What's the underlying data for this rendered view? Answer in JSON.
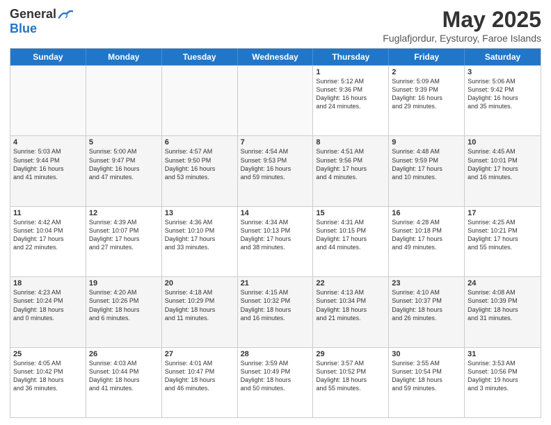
{
  "logo": {
    "general": "General",
    "blue": "Blue"
  },
  "title": "May 2025",
  "subtitle": "Fuglafjordur, Eysturoy, Faroe Islands",
  "headers": [
    "Sunday",
    "Monday",
    "Tuesday",
    "Wednesday",
    "Thursday",
    "Friday",
    "Saturday"
  ],
  "rows": [
    [
      {
        "day": "",
        "info": "",
        "empty": true
      },
      {
        "day": "",
        "info": "",
        "empty": true
      },
      {
        "day": "",
        "info": "",
        "empty": true
      },
      {
        "day": "",
        "info": "",
        "empty": true
      },
      {
        "day": "1",
        "info": "Sunrise: 5:12 AM\nSunset: 9:36 PM\nDaylight: 16 hours\nand 24 minutes."
      },
      {
        "day": "2",
        "info": "Sunrise: 5:09 AM\nSunset: 9:39 PM\nDaylight: 16 hours\nand 29 minutes."
      },
      {
        "day": "3",
        "info": "Sunrise: 5:06 AM\nSunset: 9:42 PM\nDaylight: 16 hours\nand 35 minutes."
      }
    ],
    [
      {
        "day": "4",
        "info": "Sunrise: 5:03 AM\nSunset: 9:44 PM\nDaylight: 16 hours\nand 41 minutes.",
        "alt": true
      },
      {
        "day": "5",
        "info": "Sunrise: 5:00 AM\nSunset: 9:47 PM\nDaylight: 16 hours\nand 47 minutes.",
        "alt": true
      },
      {
        "day": "6",
        "info": "Sunrise: 4:57 AM\nSunset: 9:50 PM\nDaylight: 16 hours\nand 53 minutes.",
        "alt": true
      },
      {
        "day": "7",
        "info": "Sunrise: 4:54 AM\nSunset: 9:53 PM\nDaylight: 16 hours\nand 59 minutes.",
        "alt": true
      },
      {
        "day": "8",
        "info": "Sunrise: 4:51 AM\nSunset: 9:56 PM\nDaylight: 17 hours\nand 4 minutes.",
        "alt": true
      },
      {
        "day": "9",
        "info": "Sunrise: 4:48 AM\nSunset: 9:59 PM\nDaylight: 17 hours\nand 10 minutes.",
        "alt": true
      },
      {
        "day": "10",
        "info": "Sunrise: 4:45 AM\nSunset: 10:01 PM\nDaylight: 17 hours\nand 16 minutes.",
        "alt": true
      }
    ],
    [
      {
        "day": "11",
        "info": "Sunrise: 4:42 AM\nSunset: 10:04 PM\nDaylight: 17 hours\nand 22 minutes."
      },
      {
        "day": "12",
        "info": "Sunrise: 4:39 AM\nSunset: 10:07 PM\nDaylight: 17 hours\nand 27 minutes."
      },
      {
        "day": "13",
        "info": "Sunrise: 4:36 AM\nSunset: 10:10 PM\nDaylight: 17 hours\nand 33 minutes."
      },
      {
        "day": "14",
        "info": "Sunrise: 4:34 AM\nSunset: 10:13 PM\nDaylight: 17 hours\nand 38 minutes."
      },
      {
        "day": "15",
        "info": "Sunrise: 4:31 AM\nSunset: 10:15 PM\nDaylight: 17 hours\nand 44 minutes."
      },
      {
        "day": "16",
        "info": "Sunrise: 4:28 AM\nSunset: 10:18 PM\nDaylight: 17 hours\nand 49 minutes."
      },
      {
        "day": "17",
        "info": "Sunrise: 4:25 AM\nSunset: 10:21 PM\nDaylight: 17 hours\nand 55 minutes."
      }
    ],
    [
      {
        "day": "18",
        "info": "Sunrise: 4:23 AM\nSunset: 10:24 PM\nDaylight: 18 hours\nand 0 minutes.",
        "alt": true
      },
      {
        "day": "19",
        "info": "Sunrise: 4:20 AM\nSunset: 10:26 PM\nDaylight: 18 hours\nand 6 minutes.",
        "alt": true
      },
      {
        "day": "20",
        "info": "Sunrise: 4:18 AM\nSunset: 10:29 PM\nDaylight: 18 hours\nand 11 minutes.",
        "alt": true
      },
      {
        "day": "21",
        "info": "Sunrise: 4:15 AM\nSunset: 10:32 PM\nDaylight: 18 hours\nand 16 minutes.",
        "alt": true
      },
      {
        "day": "22",
        "info": "Sunrise: 4:13 AM\nSunset: 10:34 PM\nDaylight: 18 hours\nand 21 minutes.",
        "alt": true
      },
      {
        "day": "23",
        "info": "Sunrise: 4:10 AM\nSunset: 10:37 PM\nDaylight: 18 hours\nand 26 minutes.",
        "alt": true
      },
      {
        "day": "24",
        "info": "Sunrise: 4:08 AM\nSunset: 10:39 PM\nDaylight: 18 hours\nand 31 minutes.",
        "alt": true
      }
    ],
    [
      {
        "day": "25",
        "info": "Sunrise: 4:05 AM\nSunset: 10:42 PM\nDaylight: 18 hours\nand 36 minutes."
      },
      {
        "day": "26",
        "info": "Sunrise: 4:03 AM\nSunset: 10:44 PM\nDaylight: 18 hours\nand 41 minutes."
      },
      {
        "day": "27",
        "info": "Sunrise: 4:01 AM\nSunset: 10:47 PM\nDaylight: 18 hours\nand 46 minutes."
      },
      {
        "day": "28",
        "info": "Sunrise: 3:59 AM\nSunset: 10:49 PM\nDaylight: 18 hours\nand 50 minutes."
      },
      {
        "day": "29",
        "info": "Sunrise: 3:57 AM\nSunset: 10:52 PM\nDaylight: 18 hours\nand 55 minutes."
      },
      {
        "day": "30",
        "info": "Sunrise: 3:55 AM\nSunset: 10:54 PM\nDaylight: 18 hours\nand 59 minutes."
      },
      {
        "day": "31",
        "info": "Sunrise: 3:53 AM\nSunset: 10:56 PM\nDaylight: 19 hours\nand 3 minutes."
      }
    ]
  ]
}
